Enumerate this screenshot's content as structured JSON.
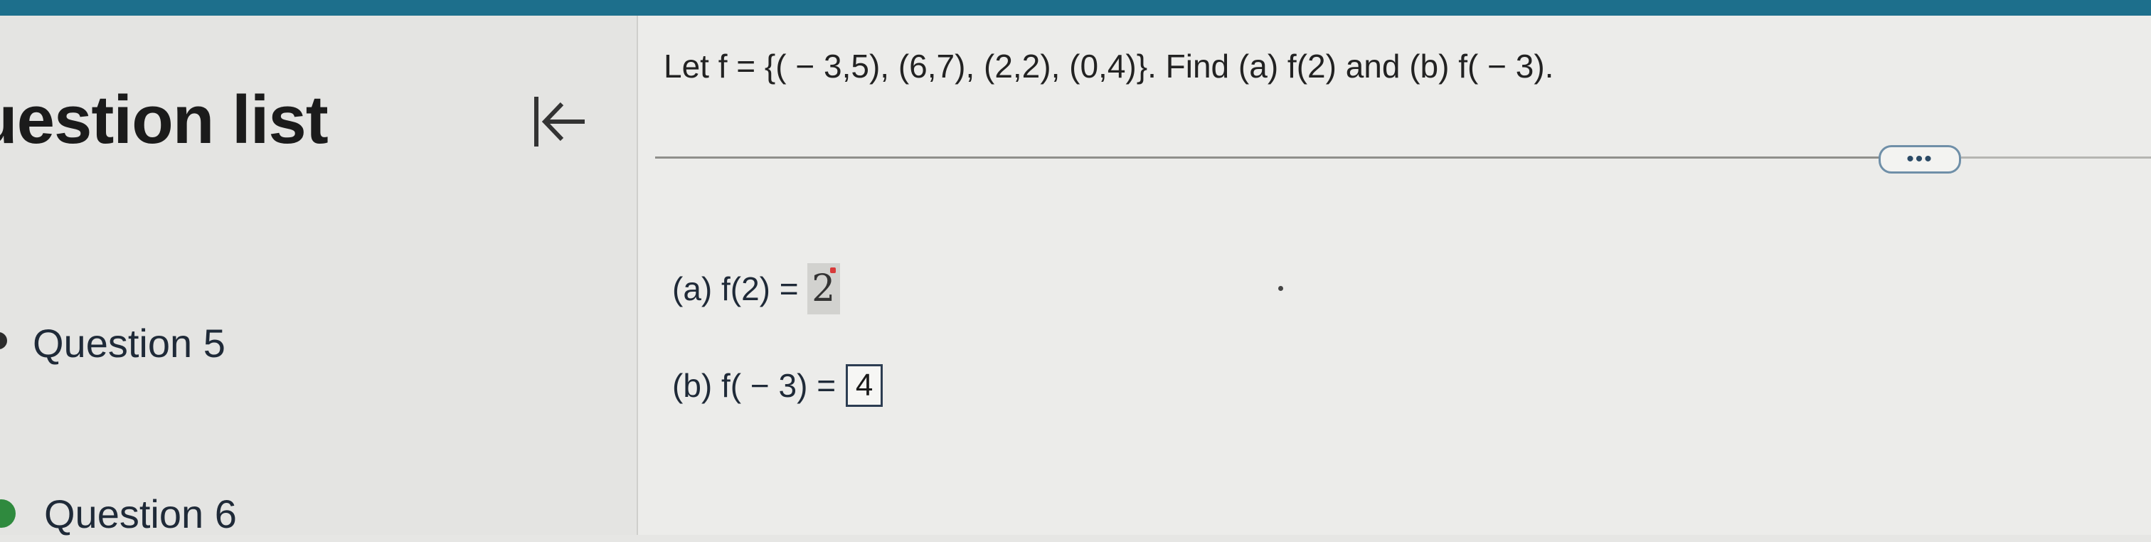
{
  "sidebar": {
    "title": "uestion list",
    "collapse_icon": "collapse-left-icon",
    "items": [
      {
        "label": "Question 5",
        "status_color": "#2b2b2b"
      },
      {
        "label": "Question 6",
        "status_color": "#2f8a3e"
      }
    ]
  },
  "question": {
    "text": "Let f = {( − 3,5), (6,7), (2,2), (0,4)}. Find (a) f(2) and (b) f( − 3).",
    "more_label": "•••",
    "part_a": {
      "label": "(a) f(2) =",
      "value": "2"
    },
    "part_b": {
      "label": "(b) f( − 3) =",
      "value": "4"
    }
  },
  "colors": {
    "topbar": "#1d6f8c",
    "accent": "#2f8a3e"
  }
}
